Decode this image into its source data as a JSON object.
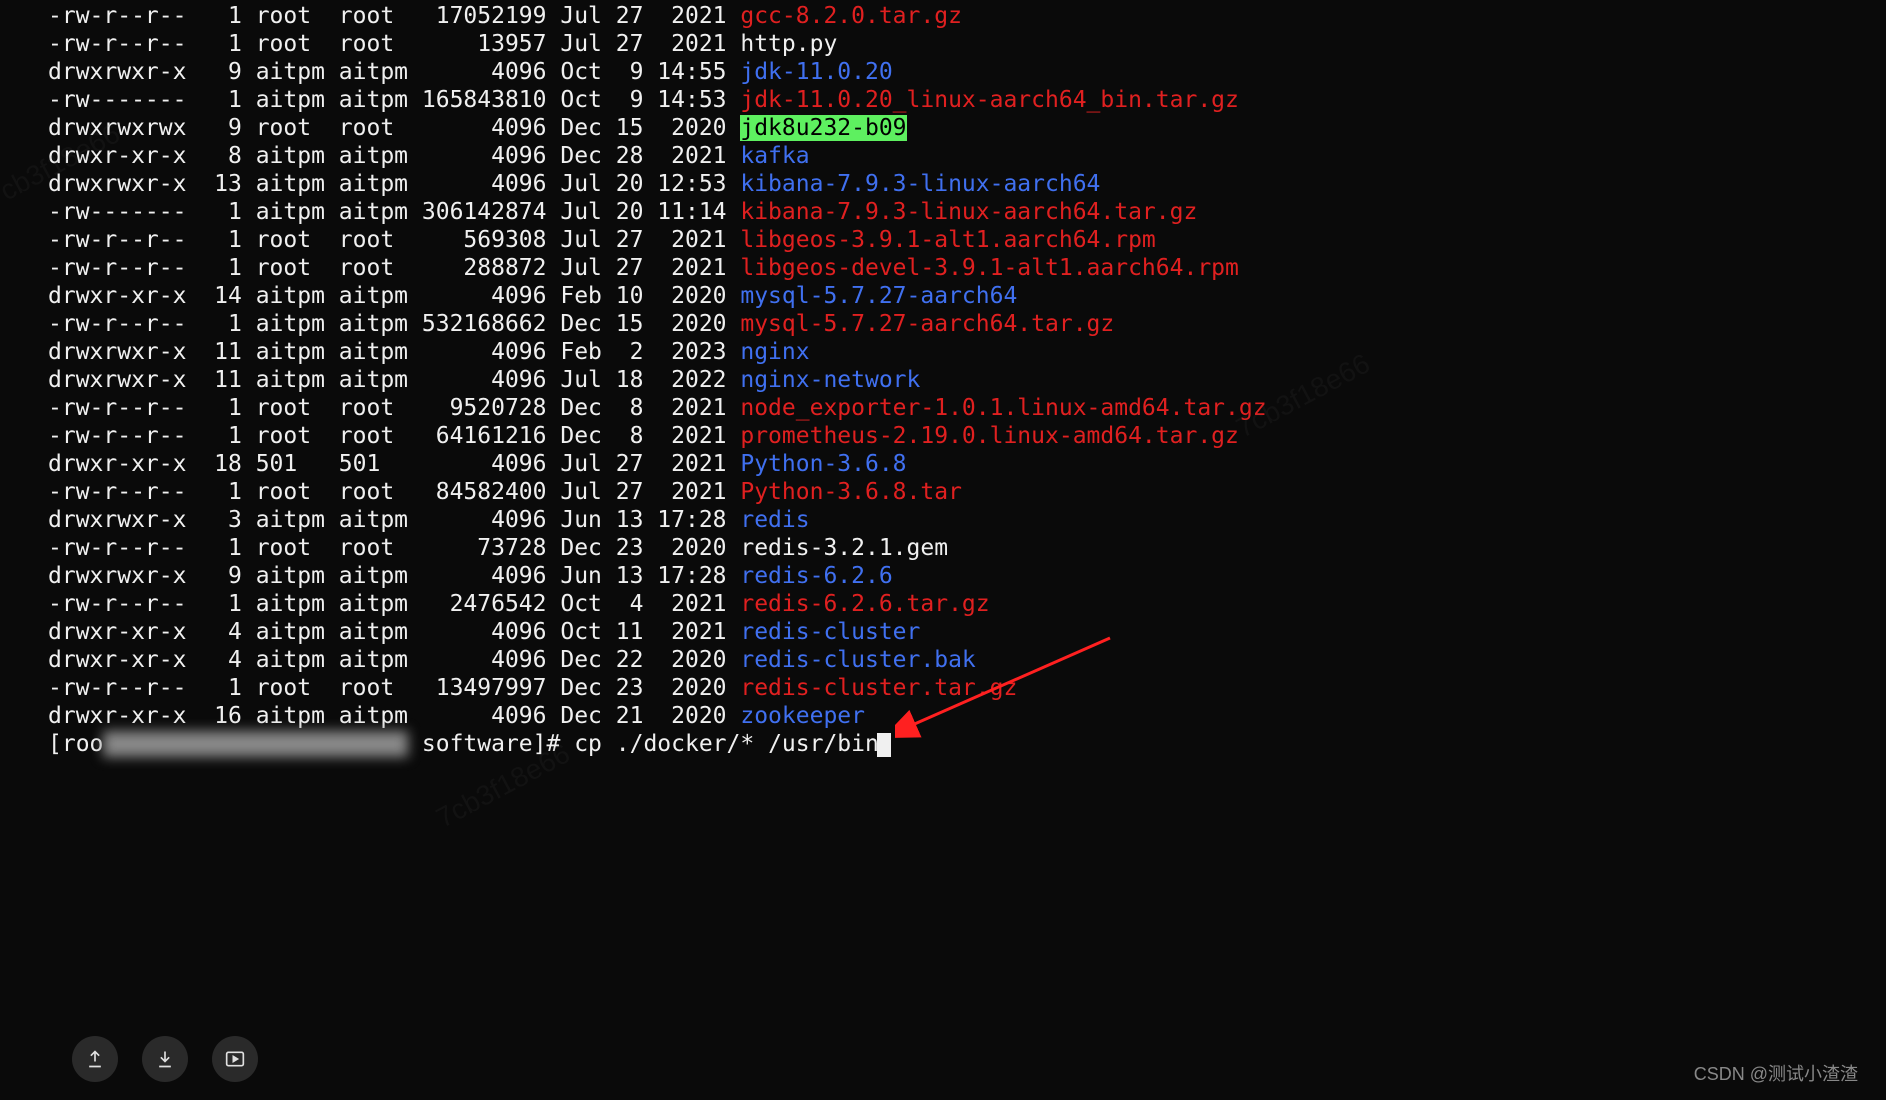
{
  "listing": [
    {
      "perm": "-rw-r--r--",
      "links": "1",
      "owner": "root",
      "group": "root",
      "size": "17052199",
      "date": "Jul 27  2021",
      "name": "gcc-8.2.0.tar.gz",
      "style": "red"
    },
    {
      "perm": "-rw-r--r--",
      "links": "1",
      "owner": "root",
      "group": "root",
      "size": "13957",
      "date": "Jul 27  2021",
      "name": "http.py",
      "style": "white"
    },
    {
      "perm": "drwxrwxr-x",
      "links": "9",
      "owner": "aitpm",
      "group": "aitpm",
      "size": "4096",
      "date": "Oct  9 14:55",
      "name": "jdk-11.0.20",
      "style": "blue"
    },
    {
      "perm": "-rw-------",
      "links": "1",
      "owner": "aitpm",
      "group": "aitpm",
      "size": "165843810",
      "date": "Oct  9 14:53",
      "name": "jdk-11.0.20_linux-aarch64_bin.tar.gz",
      "style": "red"
    },
    {
      "perm": "drwxrwxrwx",
      "links": "9",
      "owner": "root",
      "group": "root",
      "size": "4096",
      "date": "Dec 15  2020",
      "name": "jdk8u232-b09",
      "style": "hl"
    },
    {
      "perm": "drwxr-xr-x",
      "links": "8",
      "owner": "aitpm",
      "group": "aitpm",
      "size": "4096",
      "date": "Dec 28  2021",
      "name": "kafka",
      "style": "blue"
    },
    {
      "perm": "drwxrwxr-x",
      "links": "13",
      "owner": "aitpm",
      "group": "aitpm",
      "size": "4096",
      "date": "Jul 20 12:53",
      "name": "kibana-7.9.3-linux-aarch64",
      "style": "blue"
    },
    {
      "perm": "-rw-------",
      "links": "1",
      "owner": "aitpm",
      "group": "aitpm",
      "size": "306142874",
      "date": "Jul 20 11:14",
      "name": "kibana-7.9.3-linux-aarch64.tar.gz",
      "style": "red"
    },
    {
      "perm": "-rw-r--r--",
      "links": "1",
      "owner": "root",
      "group": "root",
      "size": "569308",
      "date": "Jul 27  2021",
      "name": "libgeos-3.9.1-alt1.aarch64.rpm",
      "style": "red"
    },
    {
      "perm": "-rw-r--r--",
      "links": "1",
      "owner": "root",
      "group": "root",
      "size": "288872",
      "date": "Jul 27  2021",
      "name": "libgeos-devel-3.9.1-alt1.aarch64.rpm",
      "style": "red"
    },
    {
      "perm": "drwxr-xr-x",
      "links": "14",
      "owner": "aitpm",
      "group": "aitpm",
      "size": "4096",
      "date": "Feb 10  2020",
      "name": "mysql-5.7.27-aarch64",
      "style": "blue"
    },
    {
      "perm": "-rw-r--r--",
      "links": "1",
      "owner": "aitpm",
      "group": "aitpm",
      "size": "532168662",
      "date": "Dec 15  2020",
      "name": "mysql-5.7.27-aarch64.tar.gz",
      "style": "red"
    },
    {
      "perm": "drwxrwxr-x",
      "links": "11",
      "owner": "aitpm",
      "group": "aitpm",
      "size": "4096",
      "date": "Feb  2  2023",
      "name": "nginx",
      "style": "blue"
    },
    {
      "perm": "drwxrwxr-x",
      "links": "11",
      "owner": "aitpm",
      "group": "aitpm",
      "size": "4096",
      "date": "Jul 18  2022",
      "name": "nginx-network",
      "style": "blue"
    },
    {
      "perm": "-rw-r--r--",
      "links": "1",
      "owner": "root",
      "group": "root",
      "size": "9520728",
      "date": "Dec  8  2021",
      "name": "node_exporter-1.0.1.linux-amd64.tar.gz",
      "style": "red"
    },
    {
      "perm": "-rw-r--r--",
      "links": "1",
      "owner": "root",
      "group": "root",
      "size": "64161216",
      "date": "Dec  8  2021",
      "name": "prometheus-2.19.0.linux-amd64.tar.gz",
      "style": "red"
    },
    {
      "perm": "drwxr-xr-x",
      "links": "18",
      "owner": "501",
      "group": "501",
      "size": "4096",
      "date": "Jul 27  2021",
      "name": "Python-3.6.8",
      "style": "blue"
    },
    {
      "perm": "-rw-r--r--",
      "links": "1",
      "owner": "root",
      "group": "root",
      "size": "84582400",
      "date": "Jul 27  2021",
      "name": "Python-3.6.8.tar",
      "style": "red"
    },
    {
      "perm": "drwxrwxr-x",
      "links": "3",
      "owner": "aitpm",
      "group": "aitpm",
      "size": "4096",
      "date": "Jun 13 17:28",
      "name": "redis",
      "style": "blue"
    },
    {
      "perm": "-rw-r--r--",
      "links": "1",
      "owner": "root",
      "group": "root",
      "size": "73728",
      "date": "Dec 23  2020",
      "name": "redis-3.2.1.gem",
      "style": "white"
    },
    {
      "perm": "drwxrwxr-x",
      "links": "9",
      "owner": "aitpm",
      "group": "aitpm",
      "size": "4096",
      "date": "Jun 13 17:28",
      "name": "redis-6.2.6",
      "style": "blue"
    },
    {
      "perm": "-rw-r--r--",
      "links": "1",
      "owner": "aitpm",
      "group": "aitpm",
      "size": "2476542",
      "date": "Oct  4  2021",
      "name": "redis-6.2.6.tar.gz",
      "style": "red"
    },
    {
      "perm": "drwxr-xr-x",
      "links": "4",
      "owner": "aitpm",
      "group": "aitpm",
      "size": "4096",
      "date": "Oct 11  2021",
      "name": "redis-cluster",
      "style": "blue"
    },
    {
      "perm": "drwxr-xr-x",
      "links": "4",
      "owner": "aitpm",
      "group": "aitpm",
      "size": "4096",
      "date": "Dec 22  2020",
      "name": "redis-cluster.bak",
      "style": "blue"
    },
    {
      "perm": "-rw-r--r--",
      "links": "1",
      "owner": "root",
      "group": "root",
      "size": "13497997",
      "date": "Dec 23  2020",
      "name": "redis-cluster.tar.gz",
      "style": "red"
    },
    {
      "perm": "drwxr-xr-x",
      "links": "16",
      "owner": "aitpm",
      "group": "aitpm",
      "size": "4096",
      "date": "Dec 21  2020",
      "name": "zookeeper",
      "style": "blue"
    }
  ],
  "prompt": {
    "user_prefix": "[roo",
    "blurred": "xxxxxxx xxxxxxxx xxxxx",
    "dir_suffix": " software]# ",
    "command": "cp ./docker/* /usr/bin"
  },
  "watermark": "7cb3f18e66",
  "credit": "CSDN @测试小渣渣",
  "columns": {
    "perm": 10,
    "links": 3,
    "owner": 5,
    "group": 5,
    "size": 9,
    "date": 12
  }
}
